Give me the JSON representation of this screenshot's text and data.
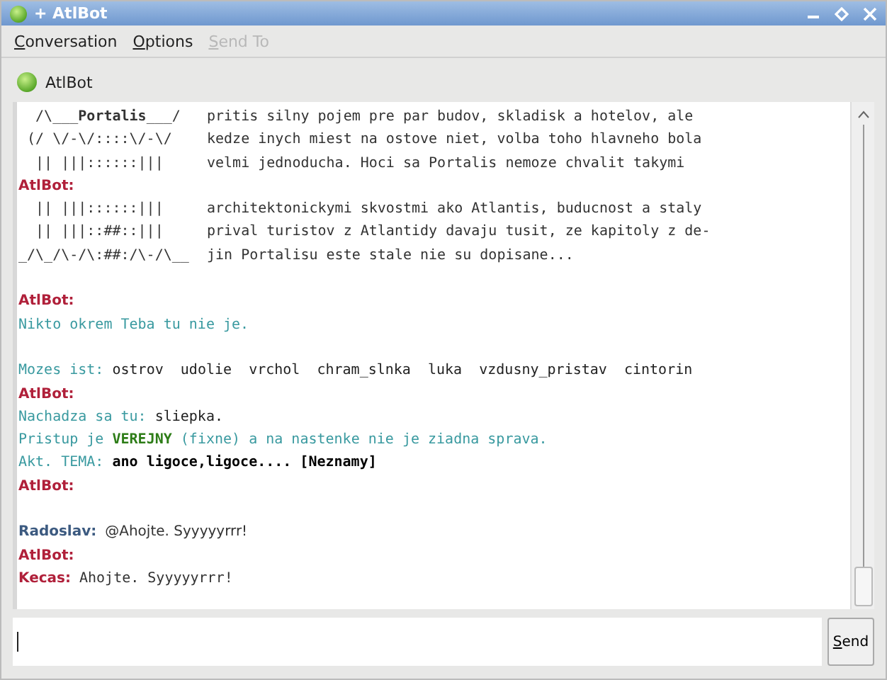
{
  "window": {
    "title": "+ AtlBot"
  },
  "menu": [
    {
      "label": "Conversation",
      "disabled": false
    },
    {
      "label": "Options",
      "disabled": false
    },
    {
      "label": "Send To",
      "disabled": true
    }
  ],
  "contact": {
    "name": "AtlBot"
  },
  "chat": [
    {
      "kind": "art",
      "art": "  /\\___**Portalis**___/",
      "text": "pritis silny pojem pre par budov, skladisk a hotelov, ale"
    },
    {
      "kind": "art",
      "art": " (/ \\/-\\/::::\\/-\\/",
      "text": "kedze inych miest na ostove niet, volba toho hlavneho bola"
    },
    {
      "kind": "art",
      "art": "  || |||::::::|||",
      "text": "velmi jednoducha. Hoci sa Portalis nemoze chvalit takymi"
    },
    {
      "kind": "speaker",
      "name": "AtlBot:",
      "color": "#b0203a"
    },
    {
      "kind": "art",
      "art": "  || |||::::::|||",
      "text": "architektonickymi skvostmi ako Atlantis, buducnost a staly"
    },
    {
      "kind": "art",
      "art": "  || |||::##::|||",
      "text": "prival turistov z Atlantidy davaju tusit, ze kapitoly z de-"
    },
    {
      "kind": "art",
      "art": "_/\\_/\\-/\\:##:/\\-/\\__",
      "text": "jin Portalisu este stale nie su dopisane..."
    },
    {
      "kind": "blank"
    },
    {
      "kind": "speaker",
      "name": "AtlBot:",
      "color": "#b0203a"
    },
    {
      "kind": "line",
      "parts": [
        {
          "kind": "info",
          "text": "Nikto okrem Teba tu nie je."
        }
      ]
    },
    {
      "kind": "blank"
    },
    {
      "kind": "line",
      "parts": [
        {
          "kind": "info",
          "text": "Mozes ist: "
        },
        {
          "kind": "plain",
          "text": "ostrov  udolie  vrchol  chram_slnka  luka  vzdusny_pristav  cintorin"
        }
      ]
    },
    {
      "kind": "speaker",
      "name": "AtlBot:",
      "color": "#b0203a"
    },
    {
      "kind": "line",
      "parts": [
        {
          "kind": "info",
          "text": "Nachadza sa tu: "
        },
        {
          "kind": "plain",
          "text": "sliepka."
        }
      ]
    },
    {
      "kind": "line",
      "parts": [
        {
          "kind": "info",
          "text": "Pristup je "
        },
        {
          "kind": "accent",
          "text": "VEREJNY"
        },
        {
          "kind": "info",
          "text": " (fixne) a na nastenke nie je ziadna sprava."
        }
      ]
    },
    {
      "kind": "line",
      "parts": [
        {
          "kind": "info",
          "text": "Akt. TEMA: "
        },
        {
          "kind": "strong",
          "text": "ano ligoce,ligoce.... [Neznamy]"
        }
      ]
    },
    {
      "kind": "speaker",
      "name": "AtlBot:",
      "color": "#b0203a"
    },
    {
      "kind": "blank"
    },
    {
      "kind": "remark",
      "name": "Radoslav:",
      "color": "#3c5a80",
      "text": "@Ahojte. Syyyyyrrr!"
    },
    {
      "kind": "speaker",
      "name": "AtlBot:",
      "color": "#b0203a"
    },
    {
      "kind": "said",
      "name": "Kecas:",
      "color": "#b0203a",
      "text": "Ahojte. Syyyyyrrr!"
    }
  ],
  "send_button": {
    "label": "Send"
  }
}
